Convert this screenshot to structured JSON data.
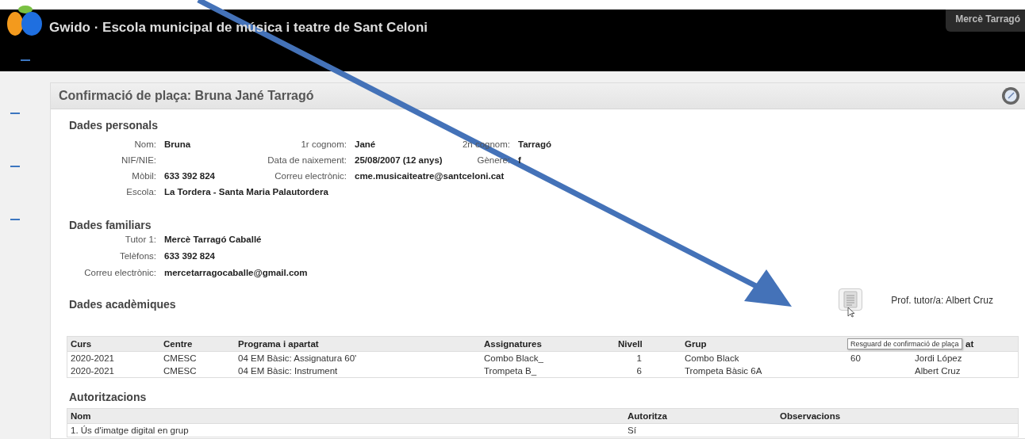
{
  "header": {
    "title": "Gwido · Escola municipal de música i teatre de Sant Celoni",
    "user": "Mercè Tarragó"
  },
  "panel": {
    "title": "Confirmació de plaça: Bruna Jané Tarragó",
    "personal": {
      "heading": "Dades personals",
      "fields": [
        {
          "label": "Nom:",
          "value": "Bruna"
        },
        {
          "label": "1r cognom:",
          "value": "Jané"
        },
        {
          "label": "2n cognom:",
          "value": "Tarragó"
        },
        {
          "label": "NIF/NIE:"
        },
        {
          "label": "Data de naixement:",
          "value": "25/08/2007 (12 anys)"
        },
        {
          "label": "Gènere:",
          "value": "f"
        },
        {
          "label": "Mòbil:",
          "value": "633 392 824"
        },
        {
          "label": "Correu electrònic:",
          "value": "cme.musicaiteatre@santceloni.cat"
        },
        {
          "label": "Escola:",
          "value": "La Tordera - Santa Maria Palautordera"
        }
      ]
    },
    "family": {
      "heading": "Dades familiars",
      "fields": [
        {
          "label": "Tutor 1:",
          "value": "Mercè Tarragó Caballé"
        },
        {
          "label": "Telèfons:",
          "value": "633 392 824"
        },
        {
          "label": "Correu electrònic:",
          "value": "mercetarragocaballe@gmail.com"
        }
      ]
    },
    "academic": {
      "heading": "Dades acadèmiques",
      "tutor": "Prof. tutor/a: Albert Cruz",
      "tooltip": "Resguard de confirmació de plaça",
      "columns": [
        "Curs",
        "Centre",
        "Programa i apartat",
        "Assignatures",
        "Nivell",
        "Grup",
        "",
        "at"
      ],
      "rows": [
        [
          "2020-2021",
          "CMESC",
          "04 EM Bàsic: Assignatura 60'",
          "Combo Black_",
          "1",
          "Combo Black",
          "60",
          "Jordi López"
        ],
        [
          "2020-2021",
          "CMESC",
          "04 EM Bàsic: Instrument",
          "Trompeta B_",
          "6",
          "Trompeta Bàsic 6A",
          "",
          "Albert Cruz"
        ]
      ]
    },
    "authorizations": {
      "heading": "Autoritzacions",
      "columns": [
        "Nom",
        "Autoritza",
        "Observacions"
      ],
      "rows": [
        [
          "1. Ús d'imatge digital en grup",
          "Sí",
          ""
        ]
      ]
    }
  }
}
